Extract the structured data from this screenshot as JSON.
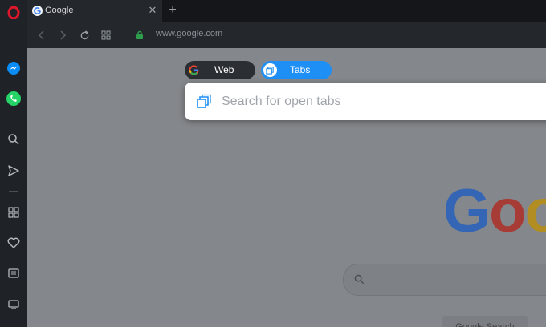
{
  "browser": {
    "tab": {
      "title": "Google",
      "close_glyph": "✕"
    },
    "new_tab_glyph": "+",
    "address": {
      "url": "www.google.com"
    }
  },
  "sidebar": {
    "items": [
      {
        "name": "opera-logo-icon"
      },
      {
        "name": "messenger-icon"
      },
      {
        "name": "whatsapp-icon"
      },
      {
        "name": "search-icon"
      },
      {
        "name": "send-icon"
      },
      {
        "name": "speed-dial-icon"
      },
      {
        "name": "heart-icon"
      },
      {
        "name": "news-icon"
      },
      {
        "name": "history-icon"
      }
    ]
  },
  "search_popup": {
    "modes": [
      {
        "label": "Web",
        "icon": "google-g-icon",
        "active": false
      },
      {
        "label": "Tabs",
        "icon": "tabs-icon",
        "active": true
      }
    ],
    "input_placeholder": "Search for open tabs",
    "input_value": ""
  },
  "page": {
    "logo_text": "Goo",
    "search_button_label": "Google Search"
  },
  "colors": {
    "accent": "#1e8ff5",
    "sidebar_bg": "#1f2226",
    "opera_red": "#e0172b",
    "whatsapp_green": "#25d366",
    "messenger_blue": "#0a8cf7"
  }
}
